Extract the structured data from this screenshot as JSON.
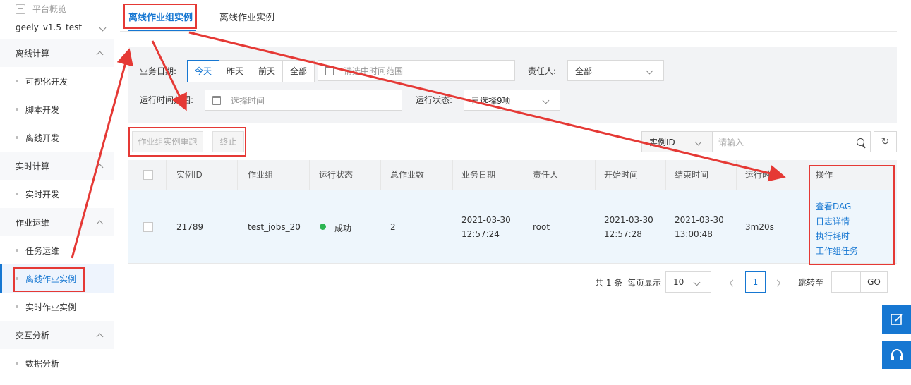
{
  "sidebar": {
    "platform_label": "平台概览",
    "project": "geely_v1.5_test",
    "groups": [
      {
        "label": "离线计算",
        "items": [
          "可视化开发",
          "脚本开发",
          "离线开发"
        ]
      },
      {
        "label": "实时计算",
        "items": [
          "实时开发"
        ]
      },
      {
        "label": "作业运维",
        "items": [
          "任务运维",
          "离线作业实例",
          "实时作业实例"
        ]
      },
      {
        "label": "交互分析",
        "items": [
          "数据分析"
        ]
      }
    ],
    "active_item": "离线作业实例"
  },
  "tabs": {
    "active": "离线作业组实例",
    "other": "离线作业实例"
  },
  "filters": {
    "biz_date_label": "业务日期:",
    "date_buttons": [
      "今天",
      "昨天",
      "前天",
      "全部"
    ],
    "date_range_placeholder": "请选中时间范围",
    "owner_label": "责任人:",
    "owner_value": "全部",
    "run_range_label": "运行时间范围:",
    "run_range_placeholder": "选择时间",
    "run_status_label": "运行状态:",
    "run_status_value": "已选择9项"
  },
  "actions": {
    "rerun": "作业组实例重跑",
    "stop": "终止"
  },
  "search": {
    "field": "实例ID",
    "placeholder": "请输入"
  },
  "table": {
    "headers": [
      "实例ID",
      "作业组",
      "运行状态",
      "总作业数",
      "业务日期",
      "责任人",
      "开始时间",
      "结束时间",
      "运行时间",
      "操作"
    ],
    "row": {
      "id": "21789",
      "group": "test_jobs_20",
      "status": "成功",
      "total": "2",
      "biz_date_1": "2021-03-30",
      "biz_date_2": "12:57:24",
      "owner": "root",
      "start_1": "2021-03-30",
      "start_2": "12:57:28",
      "end_1": "2021-03-30",
      "end_2": "13:00:48",
      "duration": "3m20s",
      "ops": [
        "查看DAG",
        "日志详情",
        "执行耗时",
        "工作组任务"
      ]
    }
  },
  "pagination": {
    "total": "共 1 条",
    "per_page_label": "每页显示",
    "per_page": "10",
    "current": "1",
    "jump_label": "跳转至",
    "go": "GO"
  },
  "colors": {
    "accent": "#1677d2",
    "annotation": "#e53935",
    "success": "#2cb552"
  }
}
